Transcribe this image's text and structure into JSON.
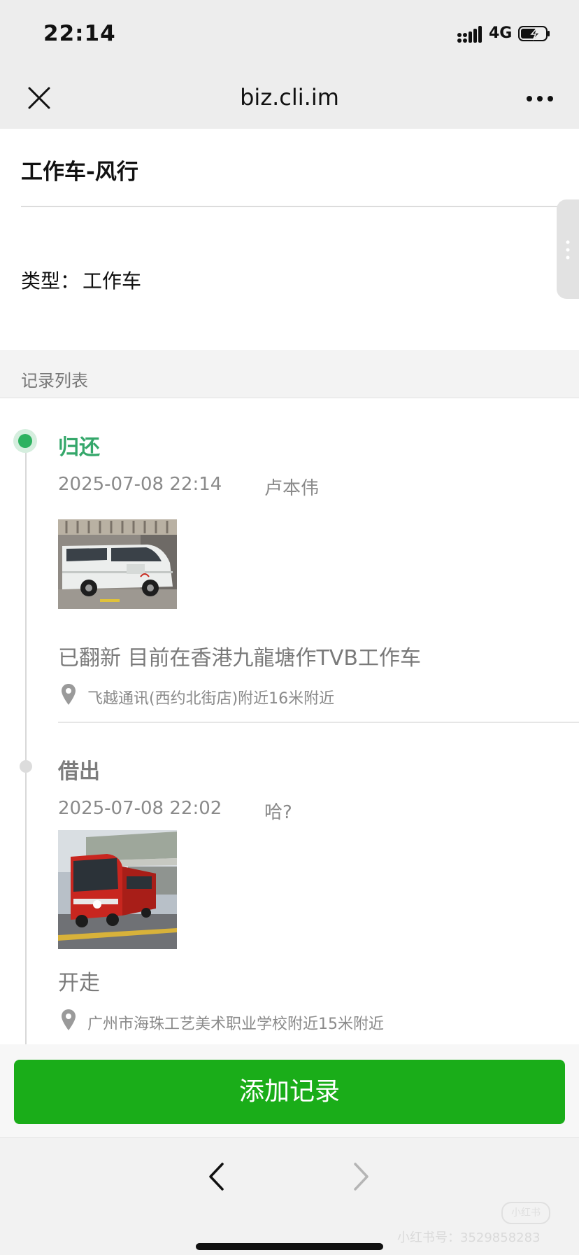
{
  "status_bar": {
    "time": "22:14",
    "network": "4G",
    "icons": [
      "signal-icon",
      "battery-charging-icon"
    ]
  },
  "nav": {
    "title": "biz.cli.im",
    "close_icon": "close-icon",
    "more_icon": "more-icon"
  },
  "header": {
    "title": "工作车-风行",
    "type_label": "类型：",
    "type_value": "工作车"
  },
  "records_section": {
    "title": "记录列表",
    "items": [
      {
        "status": "归还",
        "status_color": "#34a76a",
        "time": "2025-07-08 22:14",
        "user": "卢本伟",
        "photo": "white-van-photo",
        "note": "已翻新 目前在香港九龍塘作TVB工作车",
        "location": "飞越通讯(西约北街店)附近16米附近"
      },
      {
        "status": "借出",
        "status_color": "#7d7d7d",
        "time": "2025-07-08 22:02",
        "user": "哈?",
        "photo": "red-bus-photo",
        "note": "开走",
        "location": "广州市海珠工艺美术职业学校附近15米附近"
      }
    ]
  },
  "actions": {
    "add_record": "添加记录",
    "add_record_color": "#1aad19"
  },
  "bottom_bar": {
    "back_icon": "chevron-left-icon",
    "forward_icon": "chevron-right-icon"
  },
  "watermark": {
    "logo": "小红书",
    "id": "小红书号：3529858283"
  }
}
